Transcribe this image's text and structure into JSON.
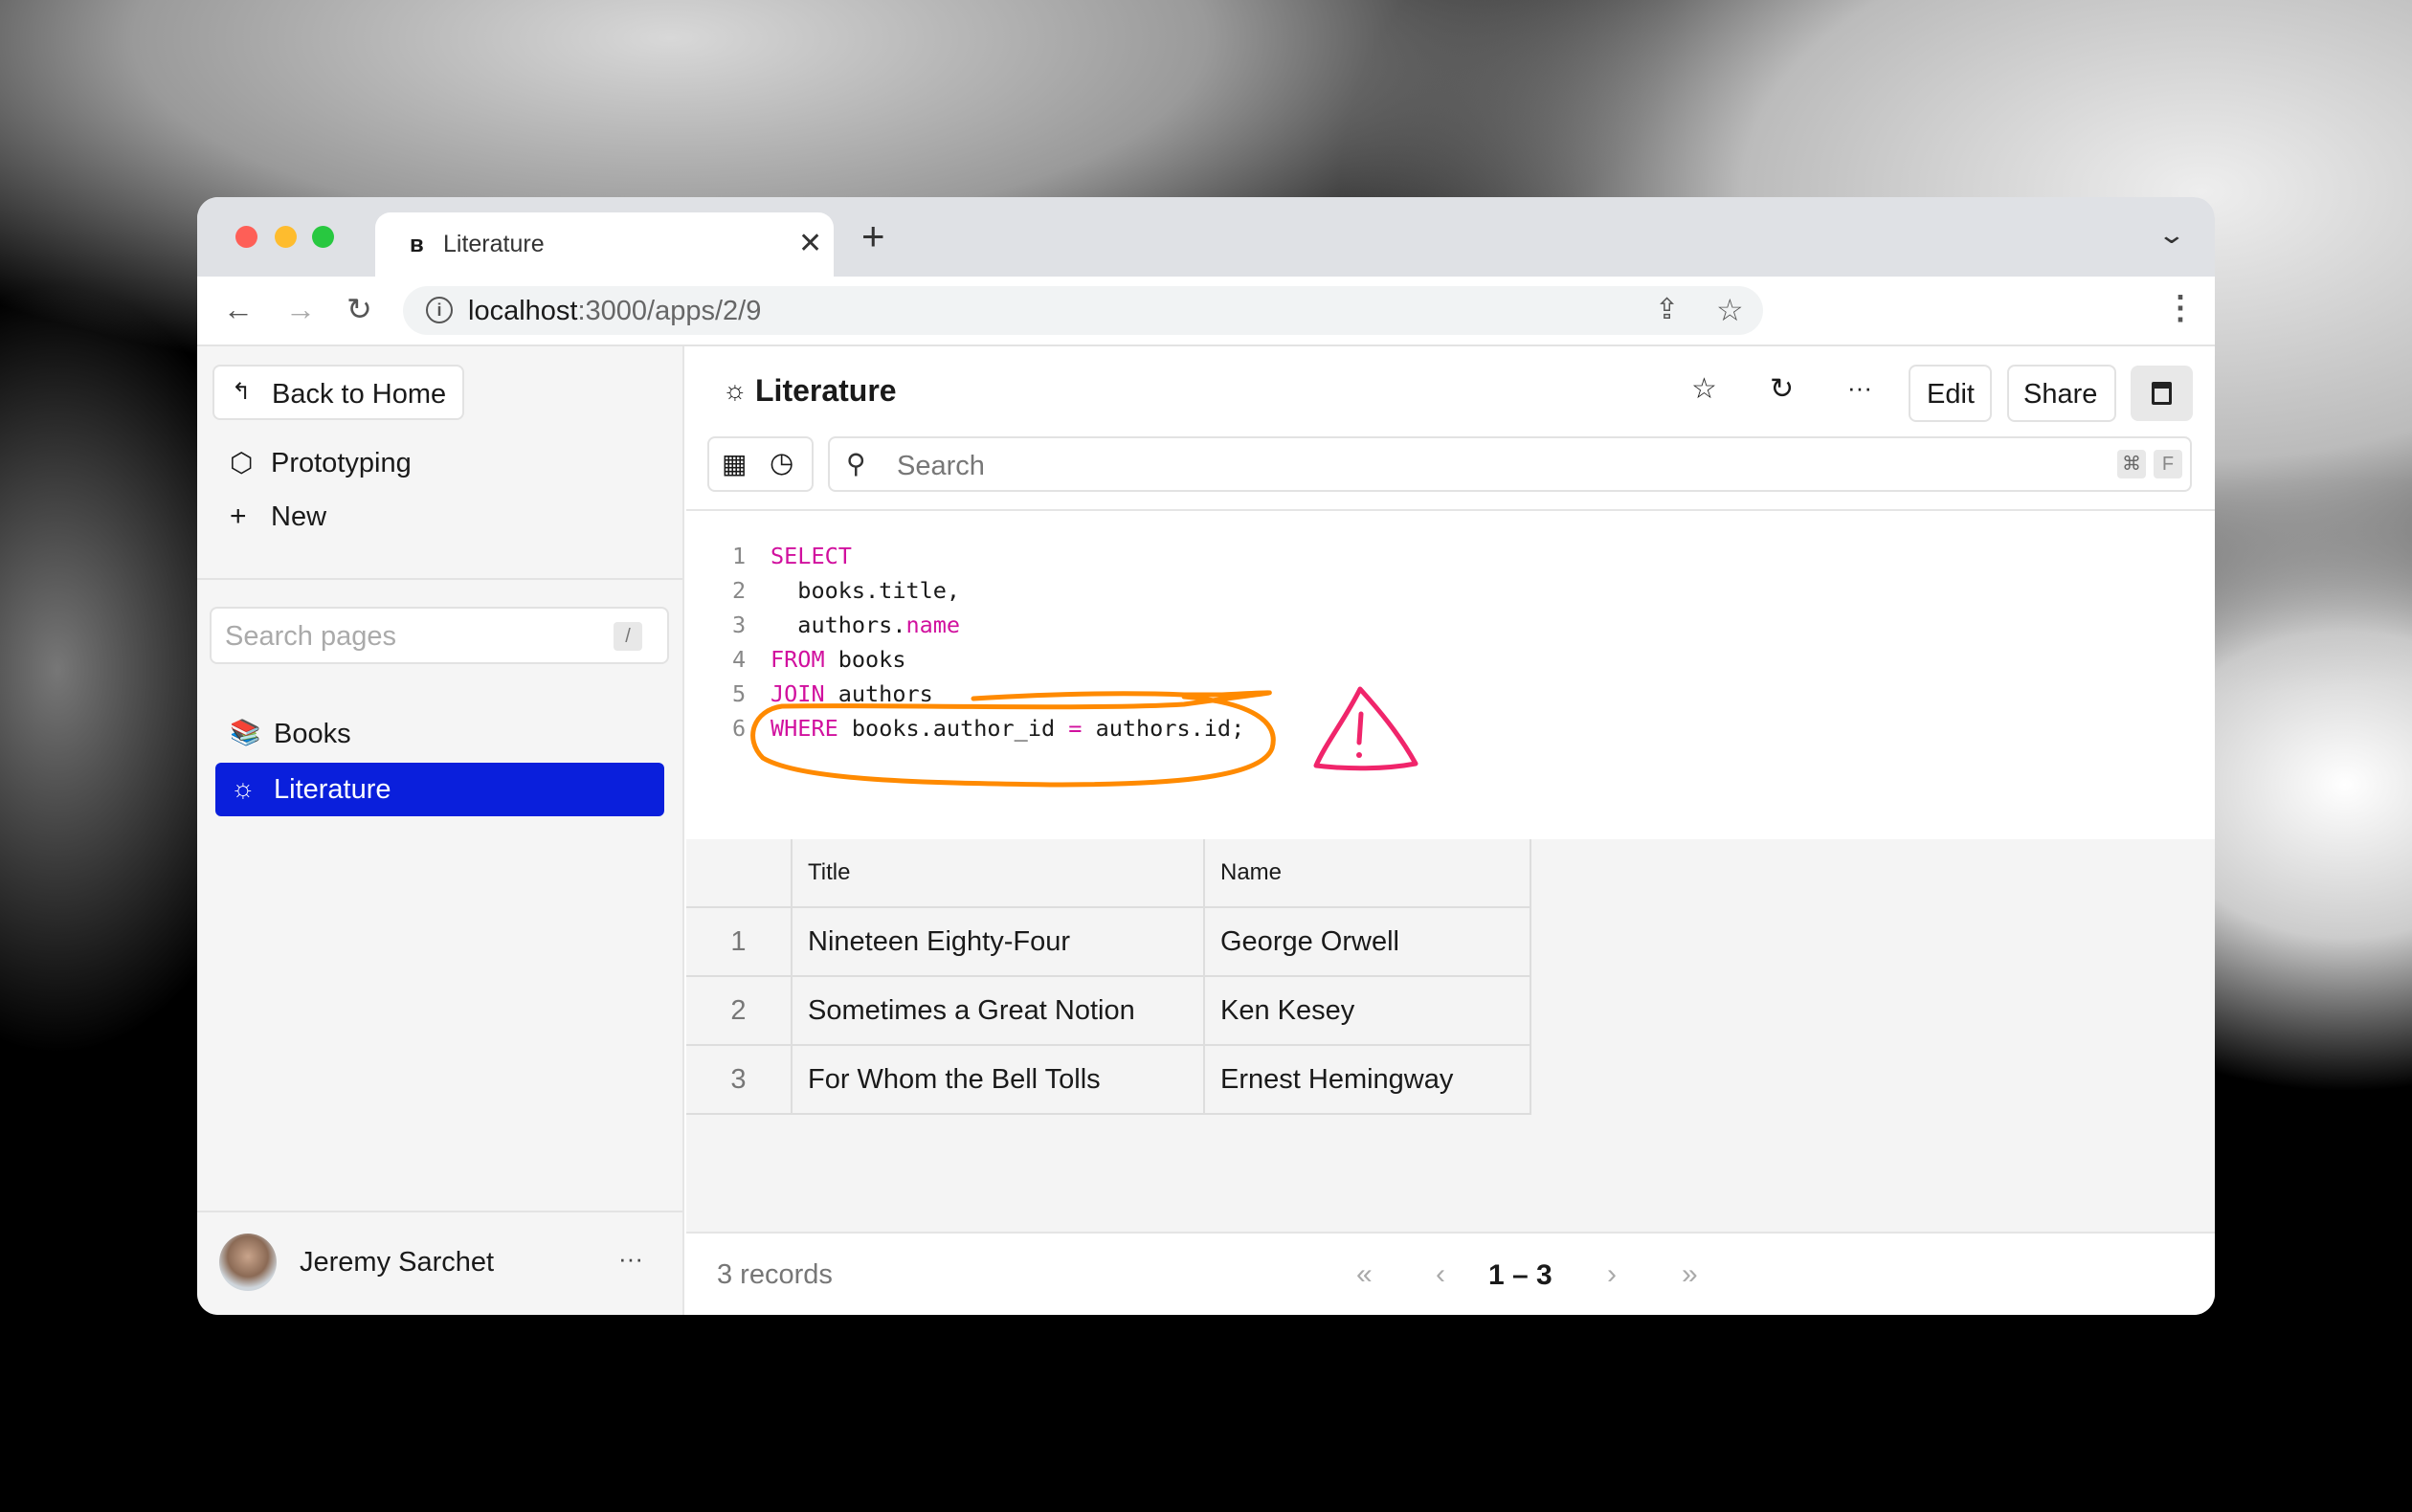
{
  "browser": {
    "tab_title": "Literature",
    "new_tab": "+",
    "url_host": "localhost",
    "url_path": ":3000/apps/2/9",
    "traffic": {
      "close": "#fe5f57",
      "minimize": "#febc2e",
      "maximize": "#28c840"
    }
  },
  "sidebar": {
    "back_label": "Back to Home",
    "items": [
      {
        "label": "Prototyping",
        "icon": "cube-icon"
      },
      {
        "label": "New",
        "icon": "plus-icon"
      }
    ],
    "search_placeholder": "Search pages",
    "search_shortcut": "/",
    "pages": [
      {
        "label": "Books",
        "icon": "books-emoji"
      },
      {
        "label": "Literature",
        "icon": "sun-icon",
        "active": true
      }
    ],
    "user": {
      "name": "Jeremy Sarchet",
      "more": "···"
    },
    "active_color": "#0a1fdc"
  },
  "header": {
    "title": "Literature",
    "edit": "Edit",
    "share": "Share",
    "more": "···"
  },
  "toolbar": {
    "search_placeholder": "Search",
    "shortcut_cmd": "⌘",
    "shortcut_key": "F"
  },
  "code": {
    "lines": [
      [
        {
          "t": "SELECT",
          "k": true
        }
      ],
      [
        {
          "t": "  books.title,"
        }
      ],
      [
        {
          "t": "  authors."
        },
        {
          "t": "name",
          "k": true
        }
      ],
      [
        {
          "t": "FROM",
          "k": true
        },
        {
          "t": " books"
        }
      ],
      [
        {
          "t": "JOIN",
          "k": true
        },
        {
          "t": " authors"
        }
      ],
      [
        {
          "t": "WHERE",
          "k": true
        },
        {
          "t": " books.author_id "
        },
        {
          "t": "=",
          "k": true
        },
        {
          "t": " authors.id;"
        }
      ]
    ],
    "keyword_color": "#d1109e",
    "annotation_color": "#ff8a00",
    "warning_color": "#f0256b"
  },
  "table": {
    "columns": [
      "Title",
      "Name"
    ],
    "rows": [
      {
        "n": "1",
        "title": "Nineteen Eighty-Four",
        "name": "George Orwell"
      },
      {
        "n": "2",
        "title": "Sometimes a Great Notion",
        "name": "Ken Kesey"
      },
      {
        "n": "3",
        "title": "For Whom the Bell Tolls",
        "name": "Ernest Hemingway"
      }
    ]
  },
  "footer": {
    "records": "3 records",
    "range": "1 – 3",
    "first": "«",
    "prev": "‹",
    "next": "›",
    "last": "»"
  }
}
